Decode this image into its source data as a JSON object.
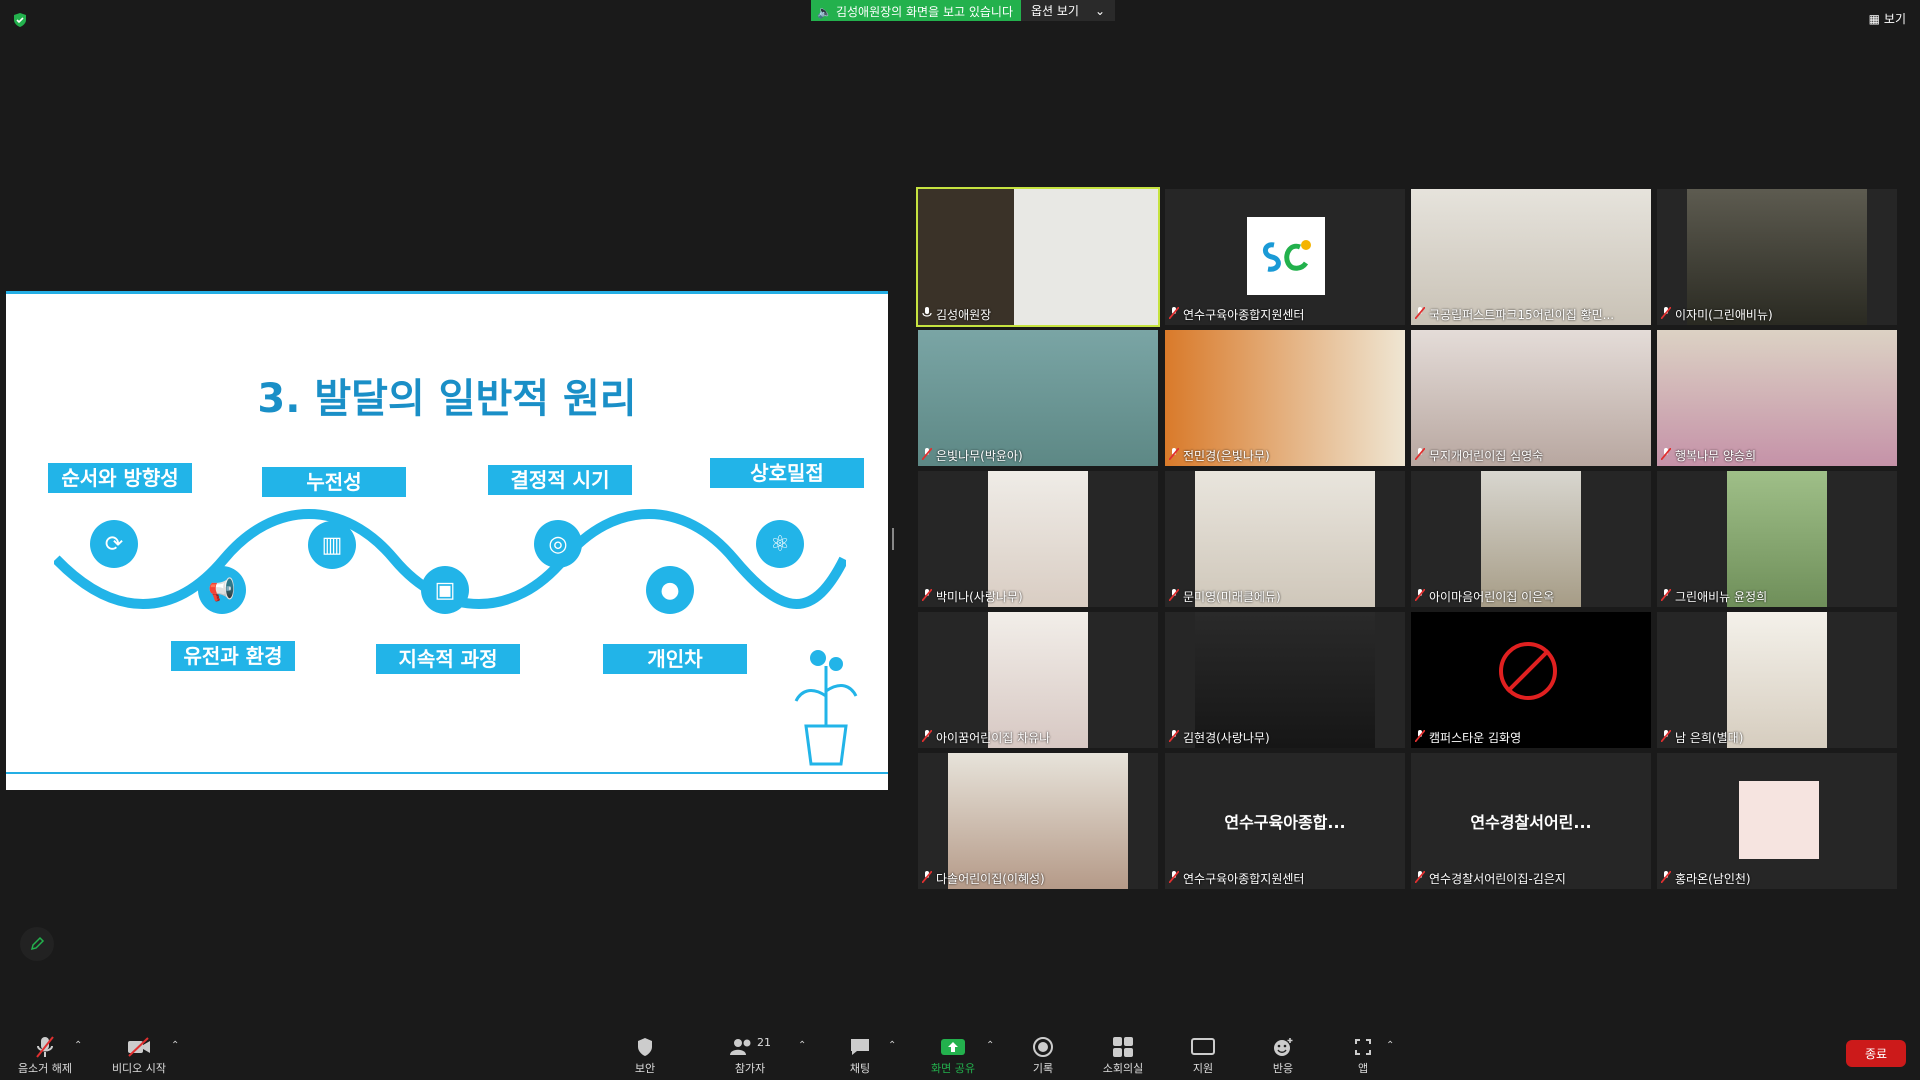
{
  "banner": {
    "sharing_text": "김성애원장의 화면을 보고 있습니다",
    "view_options": "옵션 보기",
    "view_button": "보기"
  },
  "slide": {
    "title": "3. 발달의 일반적 원리",
    "labels": [
      "순서와 방향성",
      "누전성",
      "결정적 시기",
      "상호밀접",
      "유전과 환경",
      "지속적 과정",
      "개인차"
    ]
  },
  "participants": [
    {
      "name": "김성애원장",
      "scene": "bookshelf",
      "muted": false
    },
    {
      "name": "연수구육아종합지원센터",
      "scene": "logo",
      "muted": true
    },
    {
      "name": "국공립퍼스트파크15어린이집 황민...",
      "scene": "room",
      "muted": true
    },
    {
      "name": "이자미(그린애비뉴)",
      "scene": "dark",
      "muted": true
    },
    {
      "name": "은빛나무(박윤아)",
      "scene": "teal",
      "muted": true
    },
    {
      "name": "전민경(은빛나무)",
      "scene": "orange",
      "muted": true
    },
    {
      "name": "무지개어린이집 심영숙",
      "scene": "pink",
      "muted": true
    },
    {
      "name": "행복나무 양승희",
      "scene": "apron",
      "muted": true
    },
    {
      "name": "박미나(사랑나무)",
      "scene": "face",
      "muted": true
    },
    {
      "name": "문미영(미래클에듀)",
      "scene": "room2",
      "muted": true
    },
    {
      "name": "아이마음어린이집 이은옥",
      "scene": "room3",
      "muted": true
    },
    {
      "name": "그린애비뉴 윤정희",
      "scene": "green",
      "muted": true
    },
    {
      "name": "아이꿈어린이집 차유나",
      "scene": "mask",
      "muted": true
    },
    {
      "name": "김현경(사랑나무)",
      "scene": "car",
      "muted": true
    },
    {
      "name": "캠퍼스타운 김화영",
      "scene": "nocam",
      "muted": true
    },
    {
      "name": "남 은희(별대)",
      "scene": "bright",
      "muted": true
    },
    {
      "name": "다솔어린이집(이혜성)",
      "scene": "room4",
      "muted": true
    },
    {
      "name": "연수구육아종합지원센터",
      "scene": "blank",
      "muted": true,
      "label": "연수구육아종합..."
    },
    {
      "name": "연수경찰서어린이집-김은지",
      "scene": "blank",
      "muted": true,
      "label": "연수경찰서어린..."
    },
    {
      "name": "홍라온(남인천)",
      "scene": "avatar",
      "muted": true
    }
  ],
  "toolbar": {
    "unmute": "음소거 해제",
    "start_video": "비디오 시작",
    "security": "보안",
    "participants": "참가자",
    "participants_count": "21",
    "chat": "채팅",
    "share_screen": "화면 공유",
    "record": "기록",
    "breakout": "소회의실",
    "support": "지원",
    "reactions": "반응",
    "apps": "앱",
    "end": "종료"
  },
  "colors": {
    "accent_green": "#23b14d",
    "slide_blue": "#22b4e8",
    "end_red": "#cc1a1a",
    "active_speaker": "#c6e340"
  }
}
